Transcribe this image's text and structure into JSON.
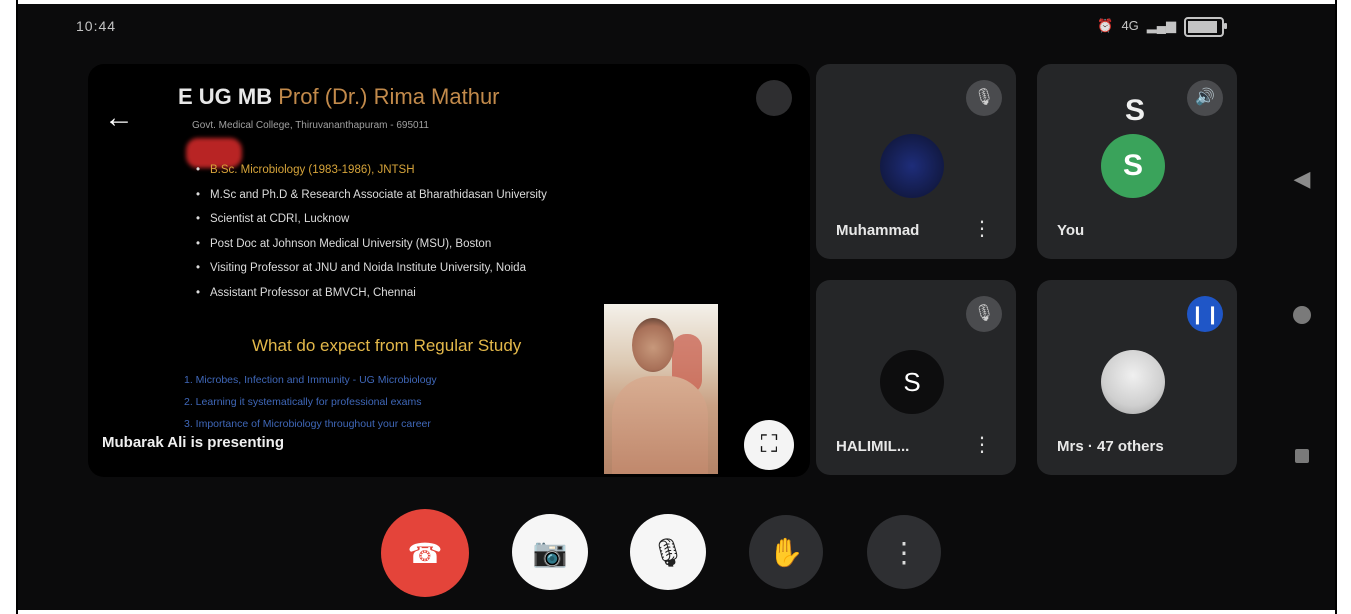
{
  "status_bar": {
    "time": "10:44",
    "signal": "4G",
    "battery": "80"
  },
  "presentation": {
    "slide": {
      "title": "E UG MB",
      "title_accent": "Prof (Dr.) Rima Mathur",
      "subtitle": "Govt. Medical College, Thiruvananthapuram - 695011",
      "bullets": [
        "B.Sc. Microbiology (1983-1986), JNTSH",
        "M.Sc and Ph.D & Research Associate at Bharathidasan University",
        "Scientist at CDRI, Lucknow",
        "Post Doc at Johnson Medical University (MSU), Boston",
        "Visiting Professor at JNU and Noida Institute University, Noida",
        "Assistant Professor at BMVCH, Chennai"
      ],
      "heading": "What do expect from Regular Study",
      "blue_lines": [
        "1. Microbes, Infection and Immunity - UG Microbiology",
        "2. Learning it systematically for professional exams",
        "3. Importance of Microbiology throughout your career"
      ]
    },
    "presenter_label": "Mubarak Ali is presenting",
    "fullscreen_icon": "fullscreen-icon"
  },
  "participants": [
    {
      "name": "Muhammad",
      "muted": true,
      "avatar": ""
    },
    {
      "name": "You",
      "muted": false,
      "avatar": "S"
    },
    {
      "name": "HALIMIL...",
      "muted": true,
      "avatar": "S"
    },
    {
      "name": "Mrs · 47 others",
      "muted": false,
      "avatar": ""
    }
  ],
  "controls": {
    "end_call": "End call",
    "camera": "Camera",
    "mic": "Microphone",
    "raise_hand": "Raise hand",
    "more": "More options"
  },
  "colors": {
    "end_call": "#e4443a",
    "active_speaker": "#1f56c7",
    "avatar_green": "#3aa35b"
  }
}
